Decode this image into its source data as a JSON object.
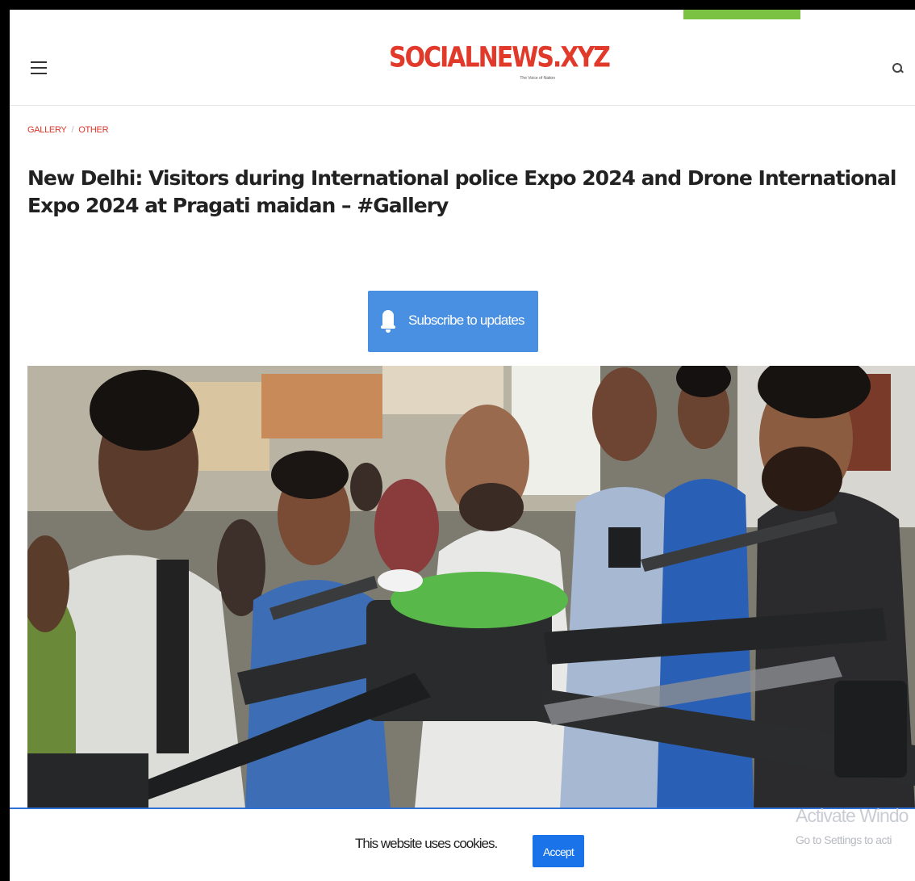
{
  "site": {
    "logo": "SOCIALNEWS.XYZ",
    "tagline": "The Voice of Nation"
  },
  "breadcrumbs": [
    "GALLERY",
    "OTHER"
  ],
  "breadcrumb_separator": "/",
  "article": {
    "title": "New Delhi: Visitors during International police Expo 2024 and Drone International Expo 2024 at Pragati maidan – #Gallery"
  },
  "subscribe": {
    "label": "Subscribe to updates"
  },
  "cookie_notice": {
    "text": "This website uses cookies.",
    "accept_label": "Accept"
  },
  "os_watermark": {
    "line1": "Activate Windo",
    "line2": "Go to Settings to acti"
  },
  "colors": {
    "brand_red": "#e23a2a",
    "accent_blue": "#4a90e2",
    "accept_blue": "#1a73e8",
    "top_tab_green": "#7cc242"
  }
}
